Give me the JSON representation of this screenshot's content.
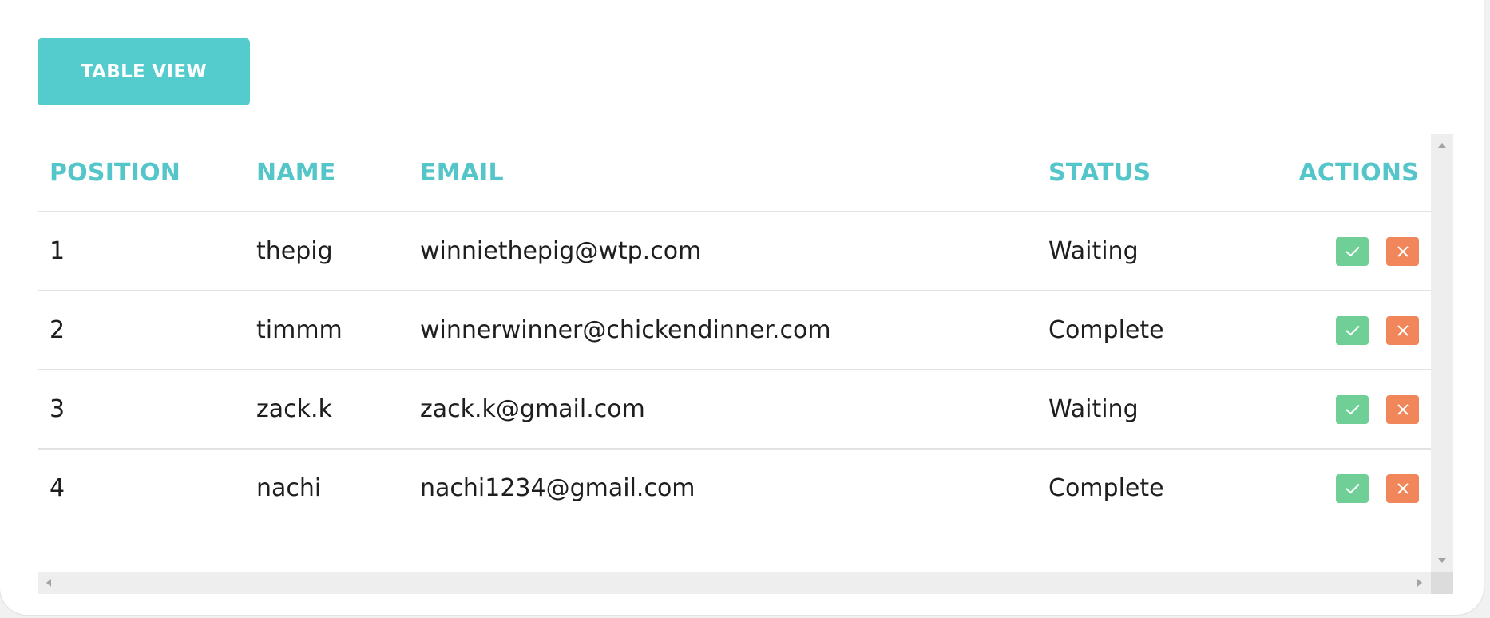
{
  "toolbar": {
    "view_button_label": "TABLE VIEW"
  },
  "table": {
    "columns": {
      "position": "POSITION",
      "name": "NAME",
      "email": "EMAIL",
      "status": "STATUS",
      "actions": "ACTIONS"
    },
    "rows": [
      {
        "position": "1",
        "name": "thepig",
        "email": "winniethepig@wtp.com",
        "status": "Waiting"
      },
      {
        "position": "2",
        "name": "timmm",
        "email": "winnerwinner@chickendinner.com",
        "status": "Complete"
      },
      {
        "position": "3",
        "name": "zack.k",
        "email": "zack.k@gmail.com",
        "status": "Waiting"
      },
      {
        "position": "4",
        "name": "nachi",
        "email": "nachi1234@gmail.com",
        "status": "Complete"
      }
    ],
    "actions": {
      "approve_icon": "check-icon",
      "reject_icon": "close-icon"
    }
  },
  "colors": {
    "accent": "#54ccce",
    "approve": "#6fcf97",
    "reject": "#f0865a",
    "text": "#1e1e1e"
  }
}
